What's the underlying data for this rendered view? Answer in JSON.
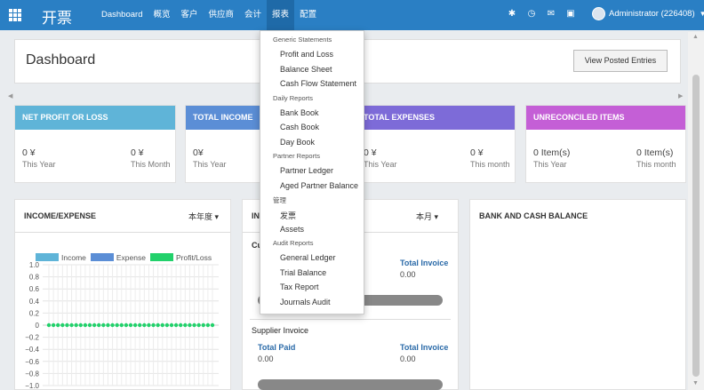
{
  "topbar": {
    "app_title": "开票",
    "menu": [
      "Dashboard",
      "概览",
      "客户",
      "供应商",
      "会计",
      "报表",
      "配置"
    ],
    "active_menu": "报表",
    "icons": [
      "bug-icon",
      "clock-icon",
      "chat-icon",
      "gift-icon"
    ],
    "user_name": "Administrator (226408)"
  },
  "control_panel": {
    "title": "Dashboard",
    "view_posted_label": "View Posted Entries"
  },
  "tiles": [
    {
      "title": "NET PROFIT OR LOSS",
      "color": "#5fb4d8",
      "v1": "0 ¥",
      "l1": "This Year",
      "v2": "0 ¥",
      "l2": "This Month"
    },
    {
      "title": "TOTAL INCOME",
      "color": "#5b8ed6",
      "v1": "0¥",
      "l1": "This Year",
      "v2": "",
      "l2": ""
    },
    {
      "title": "TOTAL EXPENSES",
      "color": "#7d6bd8",
      "v1": "0 ¥",
      "l1": "This Year",
      "v2": "0 ¥",
      "l2": "This month"
    },
    {
      "title": "UNRECONCILED ITEMS",
      "color": "#c45fd6",
      "v1": "0 Item(s)",
      "l1": "This Year",
      "v2": "0 Item(s)",
      "l2": "This month"
    }
  ],
  "panels": {
    "income_expense": {
      "title": "INCOME/EXPENSE",
      "period": "本年度 ▾"
    },
    "invoices": {
      "title": "IN",
      "period": "本月 ▾",
      "customer_label": "Cu",
      "supplier_title": "Supplier Invoice"
    },
    "bank_cash": {
      "title": "BANK AND CASH BALANCE"
    }
  },
  "invoice_fields": {
    "total_invoice_label": "Total Invoice",
    "total_invoice_value": "0.00",
    "total_paid_label": "Total Paid",
    "total_paid_value": "0.00",
    "sup_total_invoice_label": "Total Invoice",
    "sup_total_invoice_value": "0.00"
  },
  "chart_data": {
    "type": "line",
    "title": "",
    "series": [
      {
        "name": "Income",
        "color": "#5fb4d8",
        "values": [
          0,
          0,
          0,
          0,
          0,
          0,
          0,
          0,
          0,
          0,
          0,
          0,
          0,
          0,
          0,
          0,
          0,
          0,
          0,
          0,
          0,
          0,
          0,
          0,
          0,
          0,
          0,
          0,
          0,
          0,
          0,
          0,
          0,
          0,
          0,
          0,
          0
        ]
      },
      {
        "name": "Expense",
        "color": "#5b8ed6",
        "values": [
          0,
          0,
          0,
          0,
          0,
          0,
          0,
          0,
          0,
          0,
          0,
          0,
          0,
          0,
          0,
          0,
          0,
          0,
          0,
          0,
          0,
          0,
          0,
          0,
          0,
          0,
          0,
          0,
          0,
          0,
          0,
          0,
          0,
          0,
          0,
          0,
          0
        ]
      },
      {
        "name": "Profit/Loss",
        "color": "#22d16b",
        "values": [
          0,
          0,
          0,
          0,
          0,
          0,
          0,
          0,
          0,
          0,
          0,
          0,
          0,
          0,
          0,
          0,
          0,
          0,
          0,
          0,
          0,
          0,
          0,
          0,
          0,
          0,
          0,
          0,
          0,
          0,
          0,
          0,
          0,
          0,
          0,
          0,
          0
        ]
      }
    ],
    "y_ticks": [
      "1.0",
      "0.8",
      "0.6",
      "0.4",
      "0.2",
      "0",
      "−0.2",
      "−0.4",
      "−0.6",
      "−0.8",
      "−1.0"
    ],
    "ylim": [
      -1.0,
      1.0
    ],
    "legend": "top",
    "grid": true
  },
  "reports_menu": {
    "groups": [
      {
        "header": "Generic Statements",
        "items": [
          "Profit and Loss",
          "Balance Sheet",
          "Cash Flow Statement"
        ]
      },
      {
        "header": "Daily Reports",
        "items": [
          "Bank Book",
          "Cash Book",
          "Day Book"
        ]
      },
      {
        "header": "Partner Reports",
        "items": [
          "Partner Ledger",
          "Aged Partner Balance"
        ]
      },
      {
        "header": "管理",
        "items": [
          "发票",
          "Assets"
        ]
      },
      {
        "header": "Audit Reports",
        "items": [
          "General Ledger",
          "Trial Balance",
          "Tax Report",
          "Journals Audit"
        ]
      }
    ]
  }
}
